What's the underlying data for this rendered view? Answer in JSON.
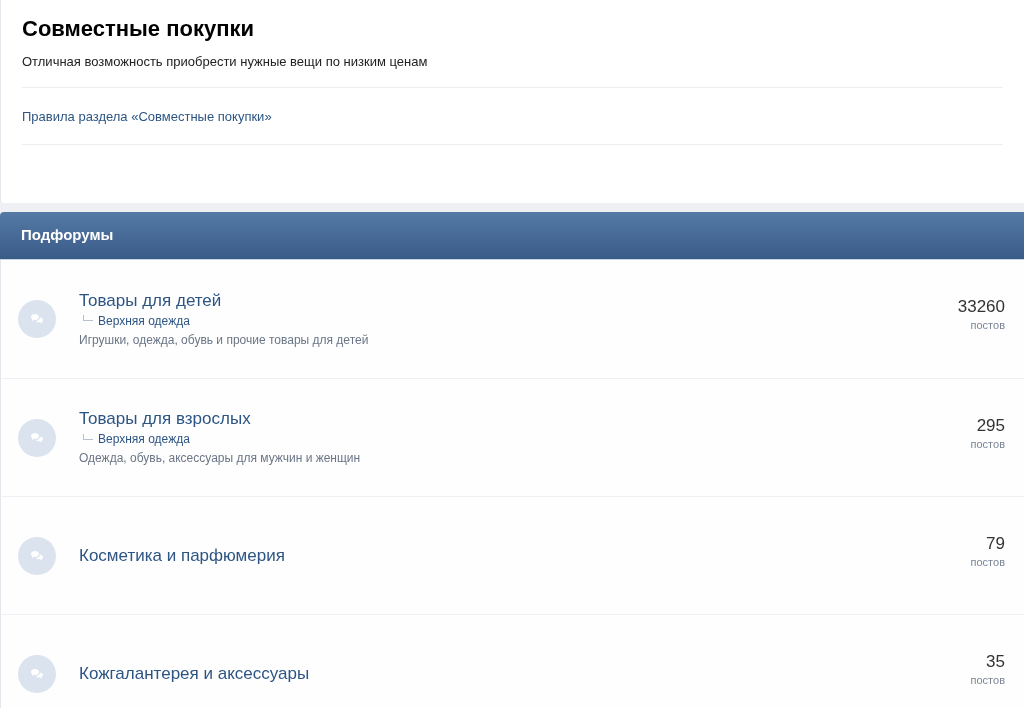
{
  "header": {
    "title": "Совместные покупки",
    "description": "Отличная возможность приобрести нужные вещи по низким ценам",
    "rules_link": "Правила раздела «Совместные покупки»"
  },
  "subforums": {
    "title": "Подфорумы",
    "rows": [
      {
        "title": "Товары для детей",
        "subforums": [
          "Верхняя одежда"
        ],
        "description": "Игрушки, одежда, обувь и прочие товары для детей",
        "count": "33260",
        "count_label": "постов"
      },
      {
        "title": "Товары для взрослых",
        "subforums": [
          "Верхняя одежда"
        ],
        "description": "Одежда, обувь, аксессуары для мужчин и женщин",
        "count": "295",
        "count_label": "постов"
      },
      {
        "title": "Косметика и парфюмерия",
        "count": "79",
        "count_label": "постов"
      },
      {
        "title": "Кожгалантерея и аксессуары",
        "count": "35",
        "count_label": "постов"
      }
    ]
  }
}
